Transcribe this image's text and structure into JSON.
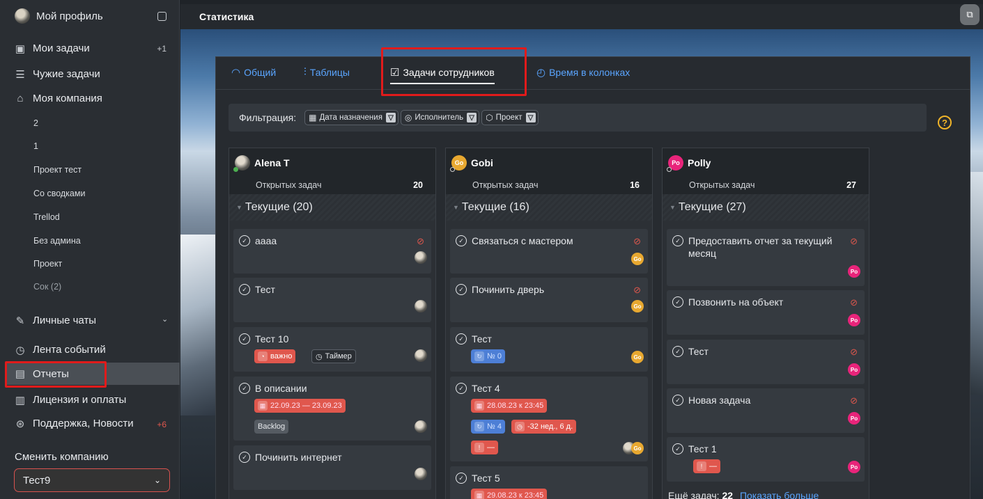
{
  "sidebar": {
    "profile": "Мой профиль",
    "my_tasks": "Мои задачи",
    "my_tasks_badge": "+1",
    "others_tasks": "Чужие задачи",
    "my_company": "Моя компания",
    "projects": [
      "2",
      "1",
      "Проект тест",
      "Со сводками",
      "Trellod",
      "Без админа",
      "Проект",
      "Сок (2)"
    ],
    "personal_chats": "Личные чаты",
    "events_feed": "Лента событий",
    "reports": "Отчеты",
    "license": "Лицензия и оплаты",
    "support": "Поддержка, Новости",
    "support_badge": "+6",
    "switch_company": "Сменить компанию",
    "company_value": "Тест9"
  },
  "topbar": {
    "title": "Статистика"
  },
  "tabs": {
    "general": "Общий",
    "tables": "Таблицы",
    "employee_tasks": "Задачи сотрудников",
    "time_in_columns": "Время в колонках"
  },
  "filters": {
    "label": "Фильтрация:",
    "assign_date": "Дата назначения",
    "executor": "Исполнитель",
    "project": "Проект"
  },
  "columns": [
    {
      "name": "Alena T",
      "initials": "",
      "open_label": "Открытых задач",
      "open_count": "20",
      "section": "Текущие (20)",
      "cards": [
        {
          "title": "аааа"
        },
        {
          "title": "Тест"
        },
        {
          "title": "Тест 10",
          "tag1": "важно",
          "tag2": "Таймер"
        },
        {
          "title": "В описании",
          "date": "22.09.23 — 23.09.23",
          "tag": "Backlog"
        },
        {
          "title": "Починить интернет"
        }
      ]
    },
    {
      "name": "Gobi",
      "initials": "Go",
      "open_label": "Открытых задач",
      "open_count": "16",
      "section": "Текущие (16)",
      "cards": [
        {
          "title": "Связаться с мастером"
        },
        {
          "title": "Починить дверь"
        },
        {
          "title": "Тест",
          "num": "№ 0"
        },
        {
          "title": "Тест 4",
          "date": "28.08.23 к 23:45",
          "num": "№ 4",
          "overdue": "-32 нед., 6 д.",
          "dash": "—",
          "av_initials": "Go"
        },
        {
          "title": "Тест 5",
          "date": "29.08.23 к 23:45"
        }
      ]
    },
    {
      "name": "Polly",
      "initials": "Po",
      "open_label": "Открытых задач",
      "open_count": "27",
      "section": "Текущие (27)",
      "cards": [
        {
          "title": "Предоставить отчет за текущий месяц"
        },
        {
          "title": "Позвонить на объект"
        },
        {
          "title": "Тест"
        },
        {
          "title": "Новая задача"
        },
        {
          "title": "Тест 1",
          "dash": "—"
        }
      ],
      "more_label": "Ещё задач:",
      "more_count": "22",
      "more_link": "Показать больше"
    }
  ]
}
